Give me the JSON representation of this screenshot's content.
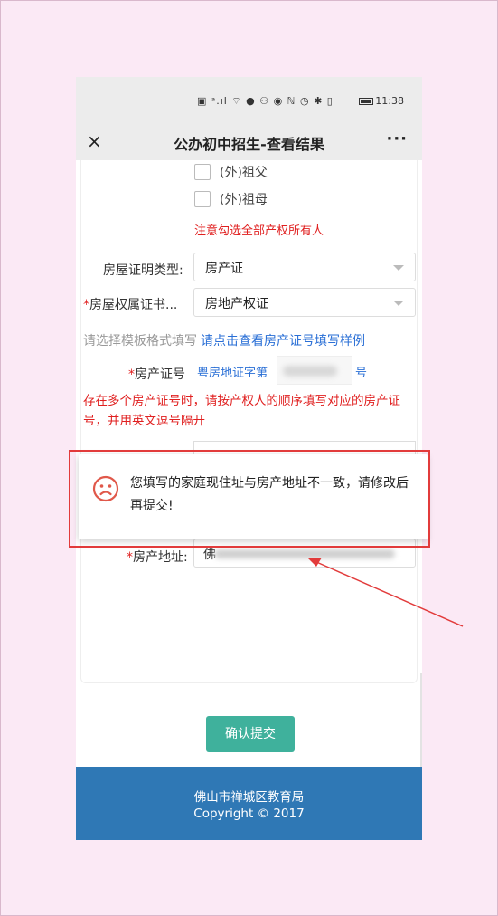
{
  "statusbar": {
    "icons": "▣ ᵃ.ıl ⌔ ● ⚇ ◉   ℕ ◷ ✱ ▯ ",
    "time": "11:38"
  },
  "header": {
    "title": "公办初中招生-查看结果",
    "close_icon": "×",
    "more_icon": "···"
  },
  "owners": {
    "items": [
      {
        "label": "(外)祖父",
        "checked": false
      },
      {
        "label": "(外)祖母",
        "checked": false
      }
    ],
    "note": "注意勾选全部产权所有人"
  },
  "form": {
    "proof_type": {
      "label": "房屋证明类型:",
      "value": "房产证"
    },
    "ownership": {
      "required": "*",
      "label": "房屋权属证书...",
      "value": "房地产权证"
    },
    "hint": {
      "text": "请选择模板格式填写",
      "link": "请点击查看房产证号填写样例"
    },
    "cert_no": {
      "required": "*",
      "label": "房产证号",
      "prefix": "粤房地证字第",
      "suffix": "号"
    },
    "warning": "存在多个房产证号时，请按产权人的顺序填写对应的房产证号，并用英文逗号隔开",
    "address": {
      "required": "*",
      "label": "房产地址:",
      "value_start": "佛"
    }
  },
  "submit_label": "确认提交",
  "footer": {
    "org": "佛山市禅城区教育局",
    "copyright": "Copyright © 2017"
  },
  "toast": {
    "icon": "sad-face-icon",
    "message": "您填写的家庭现住址与房产地址不一致，请修改后再提交!"
  },
  "colors": {
    "background": "#fbe9f5",
    "accent_red": "#e02020",
    "link_blue": "#2a6fd6",
    "button_green": "#3fb19c",
    "footer_blue": "#2f78b5",
    "annotation_red": "#e23b3b"
  }
}
